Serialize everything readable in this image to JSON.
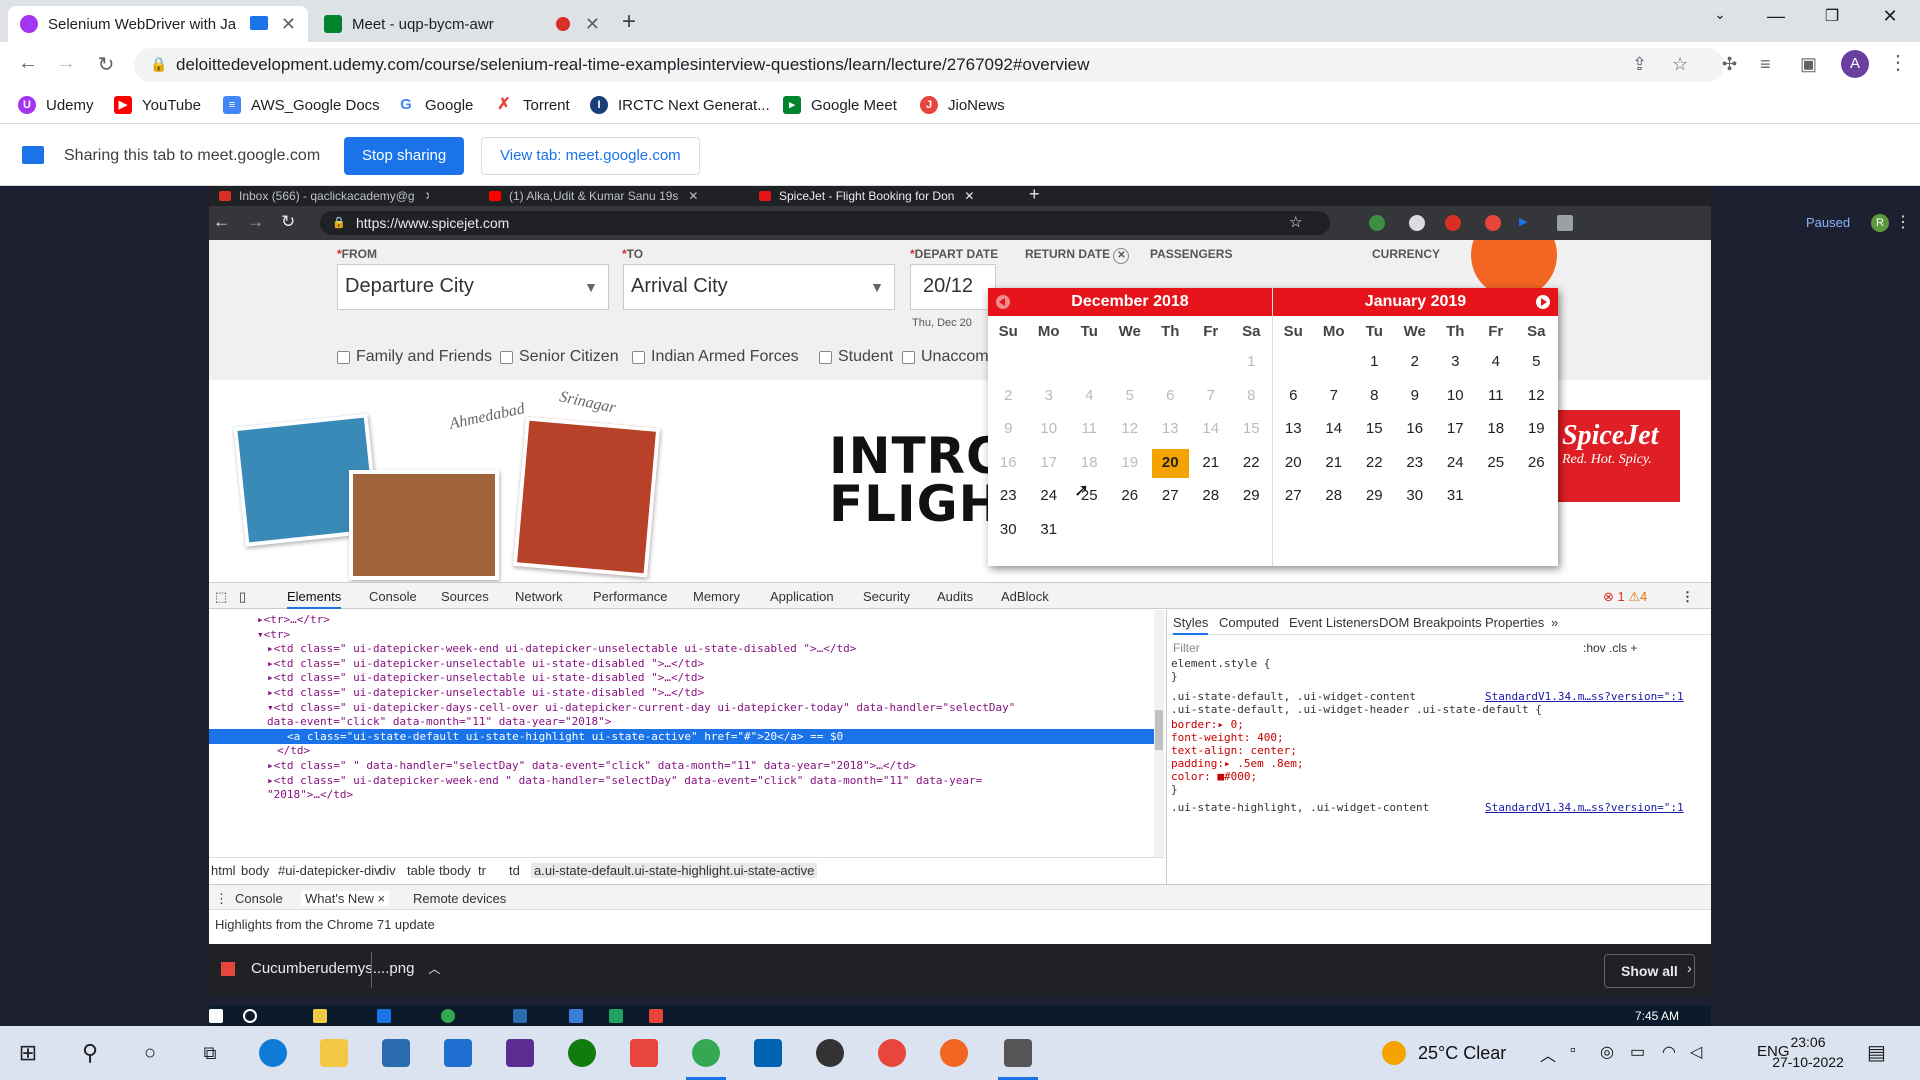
{
  "outer_browser": {
    "tabs": [
      {
        "title": "Selenium WebDriver with Ja",
        "favicon_color": "#a435f0",
        "active": true
      },
      {
        "title": "Meet - uqp-bycm-awr",
        "favicon_color": "#00832d",
        "active": false
      }
    ],
    "url": "deloittedevelopment.udemy.com/course/selenium-real-time-examplesinterview-questions/learn/lecture/2767092#overview",
    "profile_initial": "A",
    "bookmarks": [
      {
        "label": "Udemy",
        "icon_color": "#a435f0"
      },
      {
        "label": "YouTube",
        "icon_color": "#ff0000"
      },
      {
        "label": "AWS_Google Docs",
        "icon_color": "#4285f4"
      },
      {
        "label": "Google",
        "icon_color": "#4285f4"
      },
      {
        "label": "Torrent",
        "icon_color": "#e8453c"
      },
      {
        "label": "IRCTC Next Generat...",
        "icon_color": "#1a3e7a"
      },
      {
        "label": "Google Meet",
        "icon_color": "#00832d"
      },
      {
        "label": "JioNews",
        "icon_color": "#e8453c"
      }
    ]
  },
  "sharing_bar": {
    "text": "Sharing this tab to meet.google.com",
    "stop_label": "Stop sharing",
    "view_label": "View tab: meet.google.com"
  },
  "inner_browser": {
    "tabs": [
      {
        "title": "Inbox (566) - qaclickacademy@g",
        "favicon_color": "#d93025"
      },
      {
        "title": "(1) Alka,Udit & Kumar Sanu 19s",
        "favicon_color": "#ff0000"
      },
      {
        "title": "SpiceJet - Flight Booking for Don",
        "favicon_color": "#e6131b"
      }
    ],
    "url": "https://www.spicejet.com",
    "paused_label": "Paused",
    "avatar_initial": "R"
  },
  "search_form": {
    "from_label": "FROM",
    "to_label": "TO",
    "depart_label": "DEPART DATE",
    "return_label": "RETURN DATE",
    "passengers_label": "PASSENGERS",
    "currency_label": "CURRENCY",
    "from_value": "Departure City",
    "to_value": "Arrival City",
    "depart_value": "20/12",
    "depart_sub": "Thu, Dec 20",
    "checkboxes": [
      "Family and Friends",
      "Senior Citizen",
      "Indian Armed Forces",
      "Student",
      "Unaccom"
    ]
  },
  "banner": {
    "title_line1": "INTRO",
    "title_line2": "FLIGH",
    "logo_line1": "SpiceJet",
    "logo_line2": "Red. Hot. Spicy.",
    "sketch1": "Ahmedabad",
    "sketch2": "Srinagar"
  },
  "datepicker": {
    "weekdays": [
      "Su",
      "Mo",
      "Tu",
      "We",
      "Th",
      "Fr",
      "Sa"
    ],
    "months": [
      {
        "title": "December 2018",
        "offset": 6,
        "days": 31,
        "disabled_through": 19,
        "today": 20
      },
      {
        "title": "January 2019",
        "offset": 2,
        "days": 31,
        "disabled_through": 0,
        "today": 0
      }
    ]
  },
  "devtools": {
    "tabs": [
      "Elements",
      "Console",
      "Sources",
      "Network",
      "Performance",
      "Memory",
      "Application",
      "Security",
      "Audits",
      "AdBlock"
    ],
    "errors": "1",
    "warnings": "4",
    "element_lines": [
      {
        "indent": 60,
        "text": "▸<tr>…</tr>",
        "selected": false
      },
      {
        "indent": 60,
        "text": "▾<tr>",
        "selected": false
      },
      {
        "indent": 70,
        "text": "▸<td class=\" ui-datepicker-week-end ui-datepicker-unselectable ui-state-disabled \">…</td>",
        "selected": false
      },
      {
        "indent": 70,
        "text": "▸<td class=\" ui-datepicker-unselectable ui-state-disabled \">…</td>",
        "selected": false
      },
      {
        "indent": 70,
        "text": "▸<td class=\" ui-datepicker-unselectable ui-state-disabled \">…</td>",
        "selected": false
      },
      {
        "indent": 70,
        "text": "▸<td class=\" ui-datepicker-unselectable ui-state-disabled \">…</td>",
        "selected": false
      },
      {
        "indent": 70,
        "text": "▾<td class=\" ui-datepicker-days-cell-over  ui-datepicker-current-day ui-datepicker-today\" data-handler=\"selectDay\"",
        "selected": false
      },
      {
        "indent": 70,
        "text": "data-event=\"click\" data-month=\"11\" data-year=\"2018\">",
        "selected": false
      },
      {
        "indent": 90,
        "text": "<a class=\"ui-state-default ui-state-highlight ui-state-active\" href=\"#\">20</a> == $0",
        "selected": true
      },
      {
        "indent": 80,
        "text": "</td>",
        "selected": false
      },
      {
        "indent": 70,
        "text": "▸<td class=\" \" data-handler=\"selectDay\" data-event=\"click\" data-month=\"11\" data-year=\"2018\">…</td>",
        "selected": false
      },
      {
        "indent": 70,
        "text": "▸<td class=\" ui-datepicker-week-end \" data-handler=\"selectDay\" data-event=\"click\" data-month=\"11\" data-year=",
        "selected": false
      },
      {
        "indent": 70,
        "text": "\"2018\">…</td>",
        "selected": false
      }
    ],
    "style_tabs": [
      "Styles",
      "Computed",
      "Event Listeners",
      "DOM Breakpoints",
      "Properties"
    ],
    "filter_placeholder": "Filter",
    "hov_cls": ":hov  .cls  +",
    "style_lines": [
      {
        "text": "element.style {",
        "src": ""
      },
      {
        "text": "}",
        "src": ""
      },
      {
        "text": ".ui-state-default, .ui-widget-content",
        "src": "StandardV1.34.m…ss?version=\":1"
      },
      {
        "text": ".ui-state-default, .ui-widget-header .ui-state-default {",
        "src": ""
      },
      {
        "text": "  border:▸ 0;",
        "src": ""
      },
      {
        "text": "  font-weight: 400;",
        "src": ""
      },
      {
        "text": "  text-align: center;",
        "src": ""
      },
      {
        "text": "  padding:▸ .5em .8em;",
        "src": ""
      },
      {
        "text": "  color: ■#000;",
        "src": ""
      },
      {
        "text": "}",
        "src": ""
      },
      {
        "text": ".ui-state-highlight, .ui-widget-content",
        "src": "StandardV1.34.m…ss?version=\":1"
      }
    ],
    "breadcrumbs": [
      "html",
      "body",
      "#ui-datepicker-div",
      "div",
      "table",
      "tbody",
      "tr",
      "td",
      "a.ui-state-default.ui-state-highlight.ui-state-active"
    ],
    "drawer_tabs": [
      "Console",
      "What's New ×",
      "Remote devices"
    ],
    "drawer_text": "Highlights from the Chrome 71 update"
  },
  "downloads": {
    "file": "Cucumberudemys....png",
    "show_all": "Show all"
  },
  "inner_taskbar": {
    "time": "7:45 AM"
  },
  "taskbar": {
    "weather": "25°C  Clear",
    "lang": "ENG",
    "time": "23:06",
    "date": "27-10-2022"
  }
}
